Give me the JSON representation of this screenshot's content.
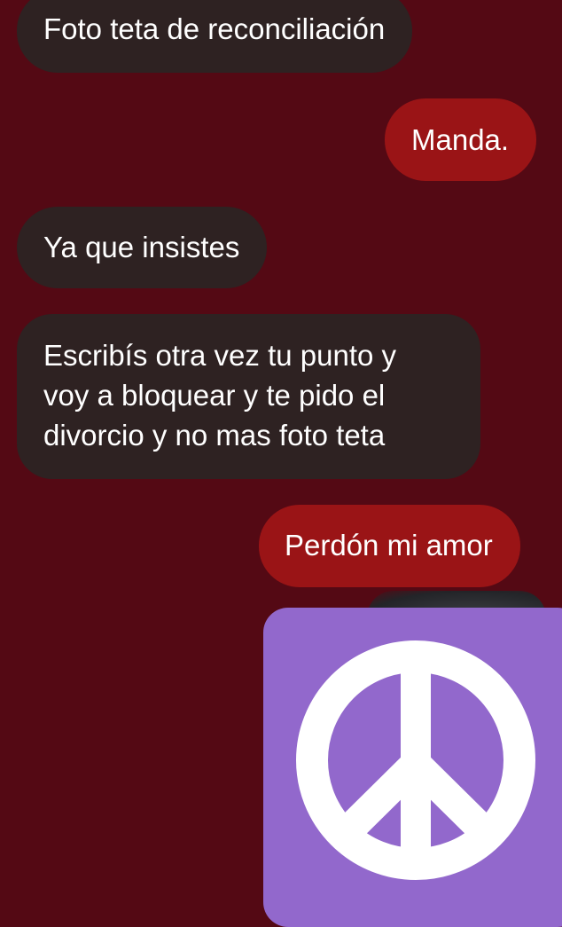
{
  "messages": [
    {
      "direction": "received",
      "text": "Foto teta de reconciliación"
    },
    {
      "direction": "sent",
      "text": "Manda."
    },
    {
      "direction": "received",
      "text": "Ya que insistes"
    },
    {
      "direction": "received",
      "lines": [
        "Escribís otra vez tu punto y",
        "voy a bloquear y te pido el",
        "divorcio y no mas foto teta"
      ]
    },
    {
      "direction": "sent",
      "text": "Perdón mi amor"
    }
  ],
  "sticker": {
    "icon": "peace-symbol-icon",
    "background": "#9268cc"
  },
  "colors": {
    "background": "#540914",
    "received_bubble": "#2e2222",
    "sent_bubble": "#9a1416"
  }
}
